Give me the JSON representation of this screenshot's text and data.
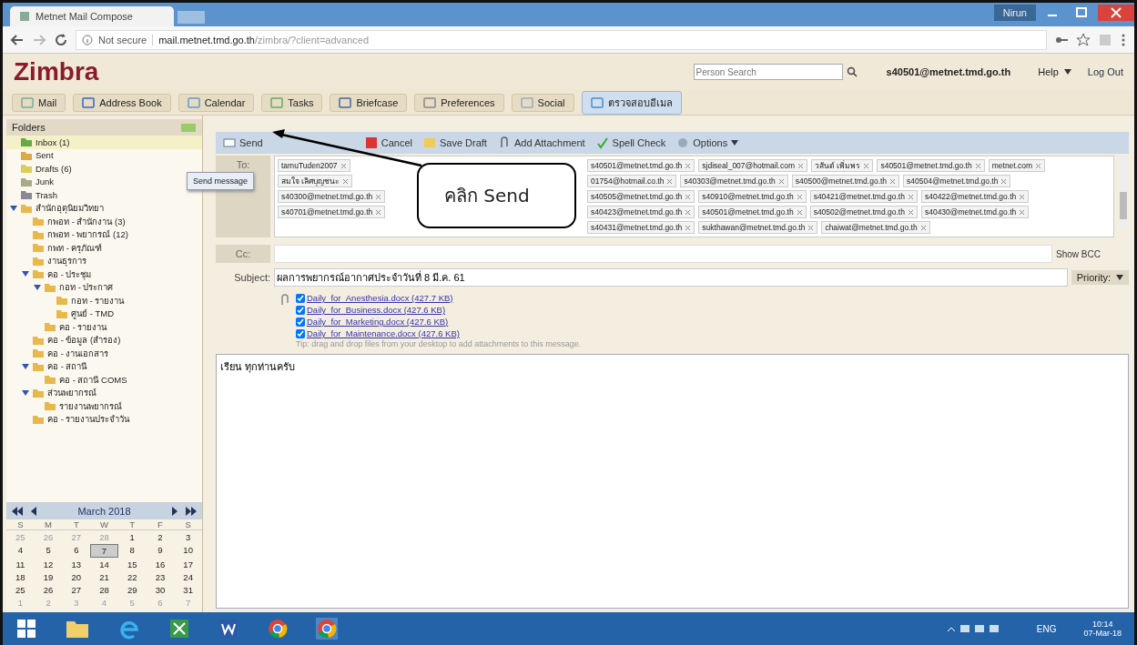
{
  "browser": {
    "tab_title": "Metnet Mail Compose",
    "user_badge": "Nirun",
    "security": "Not secure",
    "url_host": "mail.metnet.tmd.go.th",
    "url_path": "/zimbra/?client=advanced"
  },
  "header": {
    "logo": "Zimbra",
    "search": {
      "placeholder": "Person Search"
    },
    "user": "s40501@metnet.tmd.go.th",
    "help": "Help",
    "logout": "Log Out"
  },
  "app_tabs": [
    {
      "label": "Mail",
      "selected": false
    },
    {
      "label": "Address Book",
      "selected": false
    },
    {
      "label": "Calendar",
      "selected": false
    },
    {
      "label": "Tasks",
      "selected": false
    },
    {
      "label": "Briefcase",
      "selected": false
    },
    {
      "label": "Preferences",
      "selected": false
    },
    {
      "label": "Social",
      "selected": false
    },
    {
      "label": "ตรวจสอบอีเมล",
      "selected": true
    }
  ],
  "sidebar": {
    "title": "Folders",
    "folders": [
      {
        "label": "Inbox (1)",
        "kind": "inbox",
        "selected": true
      },
      {
        "label": "Sent",
        "kind": "sent",
        "selected": false
      },
      {
        "label": "Drafts (6)",
        "kind": "drafts",
        "selected": false
      },
      {
        "label": "Junk",
        "kind": "junk",
        "selected": false
      },
      {
        "label": "Trash",
        "kind": "trash",
        "selected": false
      },
      {
        "label": "สำนักอุตุนิยมวิทยา",
        "selected": false,
        "children": [
          {
            "label": "กพอท - สำนักงาน (3)",
            "selected": false
          },
          {
            "label": "กพอท - พยากรณ์ (12)",
            "selected": false
          },
          {
            "label": "กพท - ครุภัณฑ์",
            "selected": false
          },
          {
            "label": "งานธุรการ",
            "selected": false
          },
          {
            "label": "คอ - ประชุม",
            "selected": false,
            "children": [
              {
                "label": "กอท - ประกาศ",
                "selected": false,
                "children": [
                  {
                    "label": "กอท - รายงาน",
                    "selected": false
                  },
                  {
                    "label": "ศูนย์ - TMD",
                    "selected": false
                  }
                ]
              },
              {
                "label": "คอ - รายงาน",
                "selected": false
              }
            ]
          },
          {
            "label": "คอ - ข้อมูล (สำรอง)",
            "selected": false
          },
          {
            "label": "คอ - งานเอกสาร",
            "selected": false
          },
          {
            "label": "คอ - สถานี",
            "selected": false,
            "children": [
              {
                "label": "คอ - สถานี COMS",
                "selected": false
              }
            ]
          },
          {
            "label": "ส่วนพยากรณ์",
            "selected": false,
            "children": [
              {
                "label": "รายงานพยากรณ์",
                "selected": false
              }
            ]
          },
          {
            "label": "คอ - รายงานประจำวัน",
            "selected": false
          }
        ]
      }
    ]
  },
  "calendar": {
    "month": "March 2018",
    "weekdays": [
      "S",
      "M",
      "T",
      "W",
      "T",
      "F",
      "S"
    ],
    "weeks": [
      [
        {
          "day": "25",
          "selected": false,
          "other": true
        },
        {
          "day": "26",
          "selected": false,
          "other": true
        },
        {
          "day": "27",
          "selected": false,
          "other": true
        },
        {
          "day": "28",
          "selected": false,
          "other": true
        },
        {
          "day": "1",
          "selected": false,
          "other": false
        },
        {
          "day": "2",
          "selected": false,
          "other": false
        },
        {
          "day": "3",
          "selected": false,
          "other": false
        }
      ],
      [
        {
          "day": "4",
          "selected": false,
          "other": false
        },
        {
          "day": "5",
          "selected": false,
          "other": false
        },
        {
          "day": "6",
          "selected": false,
          "other": false
        },
        {
          "day": "7",
          "selected": true,
          "other": false
        },
        {
          "day": "8",
          "selected": false,
          "other": false
        },
        {
          "day": "9",
          "selected": false,
          "other": false
        },
        {
          "day": "10",
          "selected": false,
          "other": false
        }
      ],
      [
        {
          "day": "11",
          "selected": false,
          "other": false
        },
        {
          "day": "12",
          "selected": false,
          "other": false
        },
        {
          "day": "13",
          "selected": false,
          "other": false
        },
        {
          "day": "14",
          "selected": false,
          "other": false
        },
        {
          "day": "15",
          "selected": false,
          "other": false
        },
        {
          "day": "16",
          "selected": false,
          "other": false
        },
        {
          "day": "17",
          "selected": false,
          "other": false
        }
      ],
      [
        {
          "day": "18",
          "selected": false,
          "other": false
        },
        {
          "day": "19",
          "selected": false,
          "other": false
        },
        {
          "day": "20",
          "selected": false,
          "other": false
        },
        {
          "day": "21",
          "selected": false,
          "other": false
        },
        {
          "day": "22",
          "selected": false,
          "other": false
        },
        {
          "day": "23",
          "selected": false,
          "other": false
        },
        {
          "day": "24",
          "selected": false,
          "other": false
        }
      ],
      [
        {
          "day": "25",
          "selected": false,
          "other": false
        },
        {
          "day": "26",
          "selected": false,
          "other": false
        },
        {
          "day": "27",
          "selected": false,
          "other": false
        },
        {
          "day": "28",
          "selected": false,
          "other": false
        },
        {
          "day": "29",
          "selected": false,
          "other": false
        },
        {
          "day": "30",
          "selected": false,
          "other": false
        },
        {
          "day": "31",
          "selected": false,
          "other": false
        }
      ],
      [
        {
          "day": "1",
          "selected": false,
          "other": true
        },
        {
          "day": "2",
          "selected": false,
          "other": true
        },
        {
          "day": "3",
          "selected": false,
          "other": true
        },
        {
          "day": "4",
          "selected": false,
          "other": true
        },
        {
          "day": "5",
          "selected": false,
          "other": true
        },
        {
          "day": "6",
          "selected": false,
          "other": true
        },
        {
          "day": "7",
          "selected": false,
          "other": true
        }
      ]
    ]
  },
  "compose": {
    "toolbar": [
      {
        "label": "Send",
        "kind": "send"
      },
      {
        "label": "Cancel",
        "kind": "cancel"
      },
      {
        "label": "Save Draft",
        "kind": "save"
      },
      {
        "label": "Add Attachment",
        "kind": "attach"
      },
      {
        "label": "Spell Check",
        "kind": "spell"
      },
      {
        "label": "Options",
        "kind": "options"
      }
    ],
    "tooltip": "Send message",
    "to_label": "To:",
    "recipients": [
      "tamuTuden2007",
      "สมใจ เลิศบุญชนะ",
      "s40300@metnet.tmd.go.th",
      "s40701@metnet.tmd.go.th",
      "s40501@metnet.tmd.go.th",
      "sjdiseal_007@hotmail.com",
      "วสันต์ เพิ่มพร",
      "s40501@metnet.tmd.go.th",
      "metnet.com",
      "01754@hotmail.co.th",
      "s40303@metnet.tmd.go.th",
      "s40500@metnet.tmd.go.th",
      "s40504@metnet.tmd.go.th",
      "s40505@metnet.tmd.go.th",
      "s40910@metnet.tmd.go.th",
      "s40421@metnet.tmd.go.th",
      "s40422@metnet.tmd.go.th",
      "s40423@metnet.tmd.go.th",
      "s40501@metnet.tmd.go.th",
      "s40502@metnet.tmd.go.th",
      "s40430@metnet.tmd.go.th",
      "s40431@metnet.tmd.go.th",
      "sukthawan@metnet.tmd.go.th",
      "chaiwat@metnet.tmd.go.th"
    ],
    "cc_label": "Cc:",
    "show_bcc": "Show BCC",
    "subject_label": "Subject:",
    "subject": "ผลการพยากรณ์อากาศประจำวันที่ 8 มี.ค. 61",
    "priority": "Priority:",
    "attachments": [
      {
        "name": "Daily_for_Anesthesia.docx (427.7 KB)",
        "checked": true
      },
      {
        "name": "Daily_for_Business.docx (427.6 KB)",
        "checked": true
      },
      {
        "name": "Daily_for_Marketing.docx (427.6 KB)",
        "checked": true
      },
      {
        "name": "Daily_for_Maintenance.docx (427.6 KB)",
        "checked": true
      }
    ],
    "attach_hint": "Tip: drag and drop files from your desktop to add attachments to this message.",
    "body": "เรียน ทุกท่านครับ"
  },
  "callout": "คลิก Send",
  "taskbar": {
    "language": "ENG",
    "time": "10:14",
    "date": "07-Mar-18"
  }
}
